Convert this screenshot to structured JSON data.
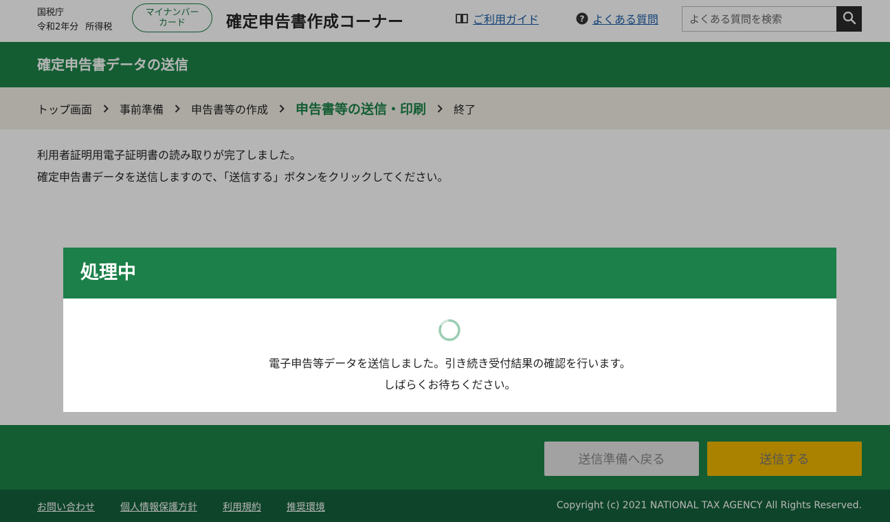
{
  "header": {
    "agency": "国税庁",
    "year": "令和2年分",
    "tax_type": "所得税",
    "mynumber_line1": "マイナンバー",
    "mynumber_line2": "カード",
    "site_title": "確定申告書作成コーナー",
    "guide_label": "ご利用ガイド",
    "faq_label": "よくある質問",
    "search_placeholder": "よくある質問を検索",
    "guide_icon": "book-icon",
    "faq_icon": "help-circle-icon",
    "search_icon": "magnifier-icon"
  },
  "section": {
    "title": "確定申告書データの送信"
  },
  "breadcrumb": {
    "items": [
      "トップ画面",
      "事前準備",
      "申告書等の作成",
      "申告書等の送信・印刷",
      "終了"
    ],
    "current_index": 3
  },
  "content": {
    "line1": "利用者証明用電子証明書の読み取りが完了しました。",
    "line2": "確定申告書データを送信しますので、「送信する」ボタンをクリックしてください。"
  },
  "actions": {
    "back_label": "送信準備へ戻る",
    "send_label": "送信する"
  },
  "footer": {
    "links": [
      "お問い合わせ",
      "個人情報保護方針",
      "利用規約",
      "推奨環境"
    ],
    "copyright": "Copyright (c) 2021 NATIONAL TAX AGENCY All Rights Reserved."
  },
  "modal": {
    "title": "処理中",
    "message_line1": "電子申告等データを送信しました。引き続き受付結果の確認を行います。",
    "message_line2": "しばらくお待ちください。"
  },
  "colors": {
    "brand_green": "#1d8348",
    "dark_green": "#14613a",
    "send_button": "#f0b800",
    "link": "#1a5ea8"
  }
}
